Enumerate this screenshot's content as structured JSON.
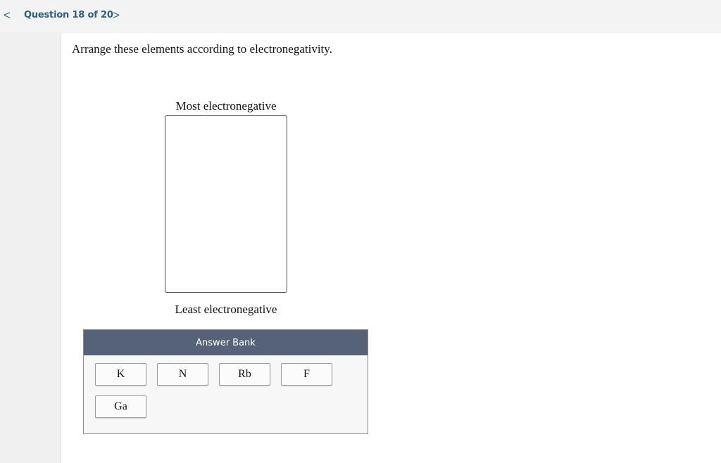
{
  "nav": {
    "prev_glyph": "<",
    "next_glyph": ">",
    "question_counter": "Question 18 of 20"
  },
  "question": {
    "prompt": "Arrange these elements according to electronegativity.",
    "top_label": "Most electronegative",
    "bottom_label": "Least electronegative"
  },
  "answer_bank": {
    "title": "Answer Bank",
    "items": [
      "K",
      "N",
      "Rb",
      "F",
      "Ga"
    ]
  },
  "colors": {
    "nav_text": "#2d5f7e",
    "bank_header": "#556277"
  }
}
